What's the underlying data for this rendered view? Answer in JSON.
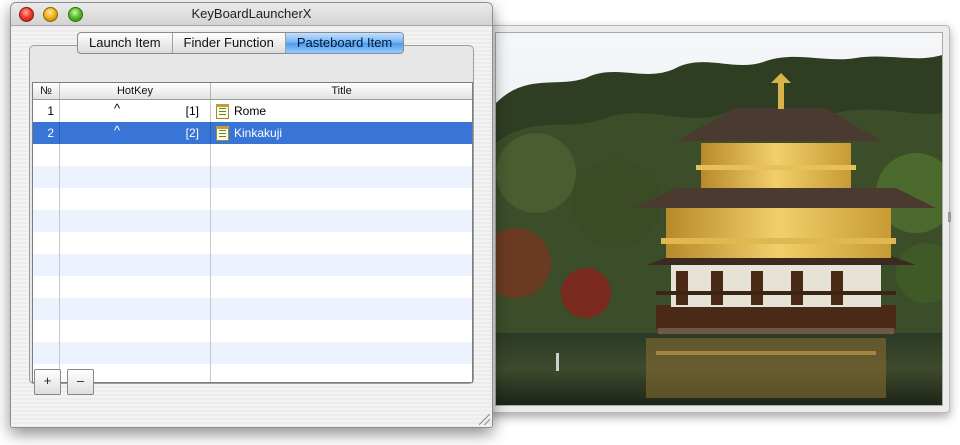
{
  "window": {
    "title": "KeyBoardLauncherX"
  },
  "tabs": [
    {
      "label": "Launch Item",
      "active": false
    },
    {
      "label": "Finder Function",
      "active": false
    },
    {
      "label": "Pasteboard Item",
      "active": true
    }
  ],
  "table": {
    "columns": [
      "№",
      "HotKey",
      "Title"
    ],
    "rows": [
      {
        "no": "1",
        "modifier": "^",
        "key": "[1]",
        "title": "Rome",
        "selected": false
      },
      {
        "no": "2",
        "modifier": "^",
        "key": "[2]",
        "title": "Kinkakuji",
        "selected": true
      }
    ]
  },
  "buttons": {
    "add_label": "+",
    "remove_label": "–"
  },
  "colors": {
    "selection": "#3875d7",
    "alt_row": "#edf3fe",
    "active_tab": "#6eb2f4"
  },
  "icons": {
    "row_item": "text-clipping-icon",
    "close": "close-icon",
    "minimize": "minimize-icon",
    "zoom": "zoom-icon"
  },
  "preview": {
    "image": "golden-pavilion-photo"
  }
}
